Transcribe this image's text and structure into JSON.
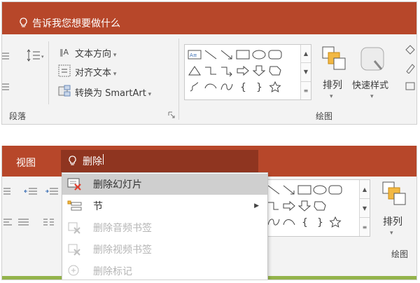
{
  "top": {
    "tell_me": "告诉我您想要做什么",
    "ribbon": {
      "text_direction": "文本方向",
      "align_text": "对齐文本",
      "convert_smartart": "转换为 SmartArt",
      "paragraph_group": "段落",
      "drawing_group": "绘图",
      "arrange": "排列",
      "quick_styles": "快速样式"
    }
  },
  "bottom": {
    "tab_view": "视图",
    "search_value": "删除",
    "drawing_group": "绘图",
    "arrange": "排列",
    "menu": [
      {
        "label": "删除幻灯片",
        "state": "highlighted",
        "icon": "delete-slide-icon"
      },
      {
        "label": "节",
        "state": "normal",
        "has_submenu": true,
        "icon": "section-icon"
      },
      {
        "label": "删除音频书签",
        "state": "disabled",
        "icon": "delete-audio-bookmark-icon"
      },
      {
        "label": "删除视频书签",
        "state": "disabled",
        "icon": "delete-video-bookmark-icon"
      },
      {
        "label": "删除标记",
        "state": "disabled",
        "icon": "delete-markup-icon"
      }
    ]
  },
  "colors": {
    "ribbon_red": "#b7472a",
    "search_box": "#8f3520",
    "accent_green": "#93b34a",
    "delete_x": "#e0402f"
  }
}
